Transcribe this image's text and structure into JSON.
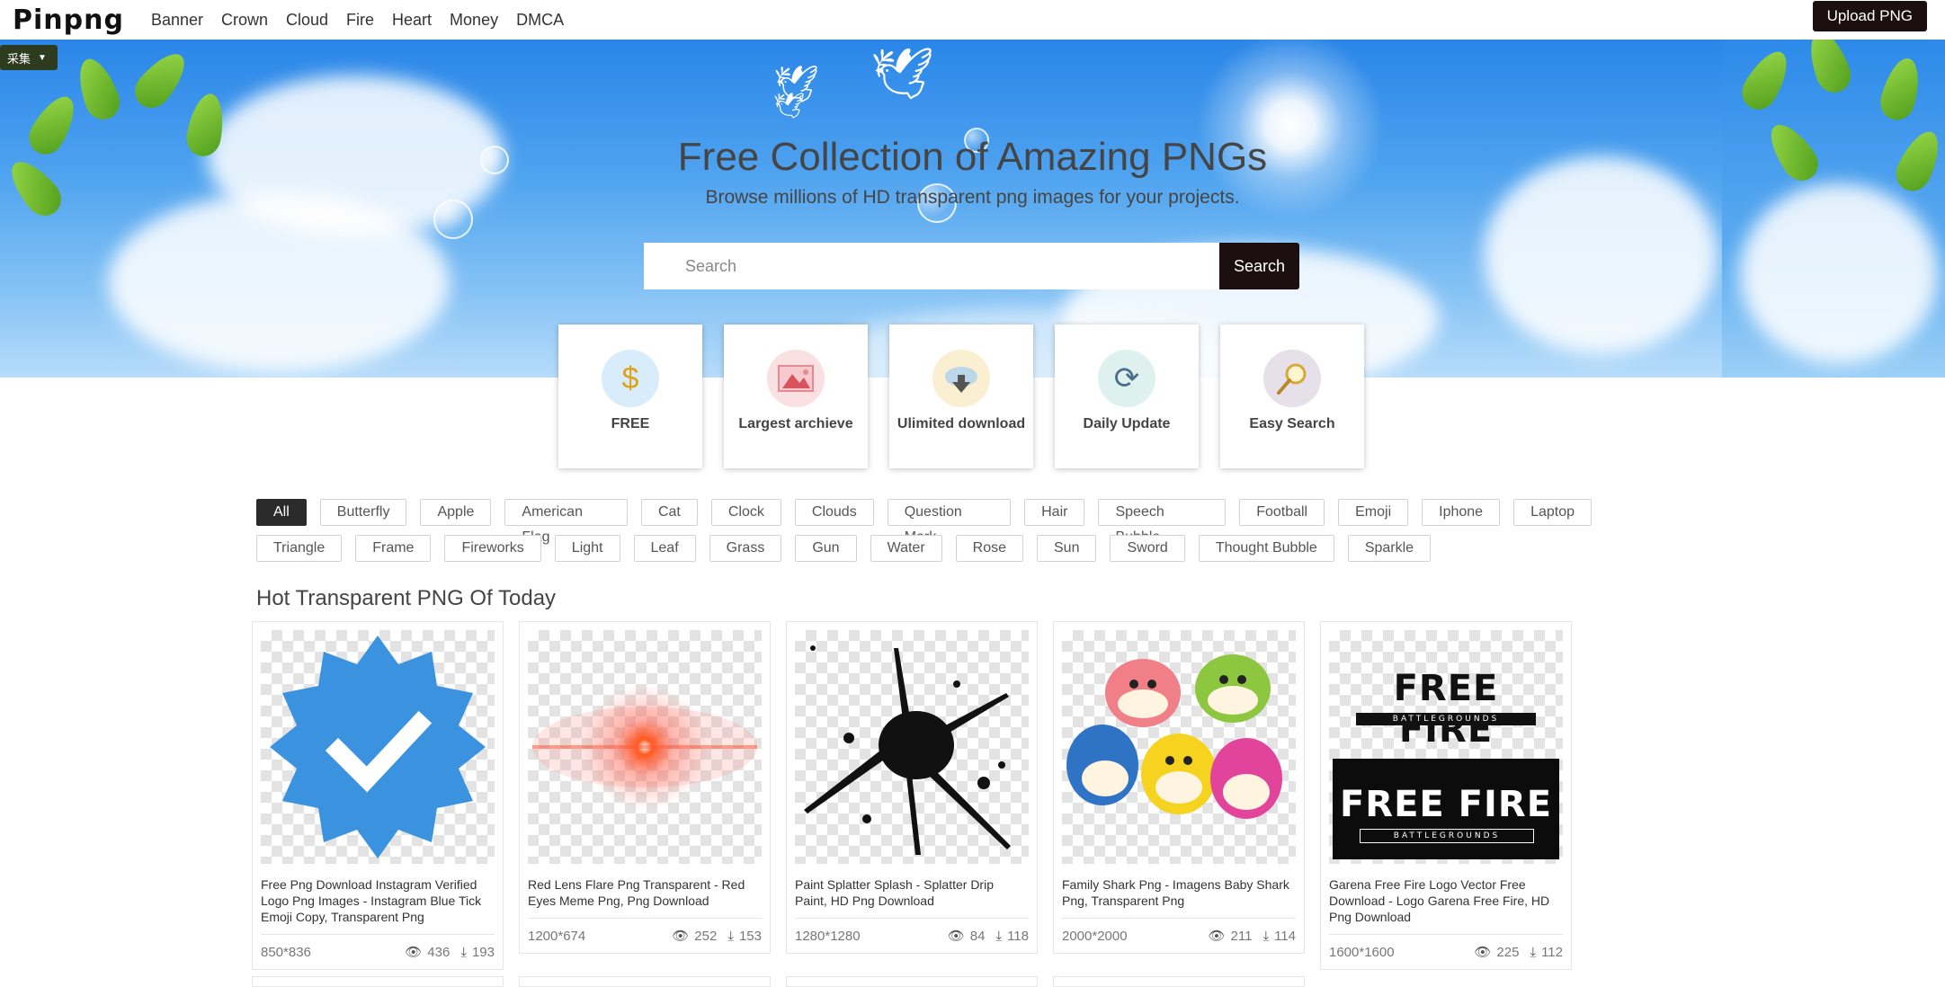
{
  "nav": {
    "logo": "Pinpng",
    "links": [
      "Banner",
      "Crown",
      "Cloud",
      "Fire",
      "Heart",
      "Money",
      "DMCA"
    ],
    "upload_label": "Upload PNG"
  },
  "overlay_badge": {
    "label": "采集",
    "dropdown_icon": "caret-down-icon"
  },
  "hero": {
    "title": "Free Collection of Amazing PNGs",
    "subtitle": "Browse millions of HD transparent png images for your projects.",
    "search": {
      "placeholder": "Search",
      "button_label": "Search"
    }
  },
  "features": [
    {
      "label": "FREE",
      "icon": "dollar-icon",
      "color": "#d9ecfb"
    },
    {
      "label": "Largest archieve",
      "icon": "image-icon",
      "color": "#fbe0e3"
    },
    {
      "label": "Ulimited download",
      "icon": "cloud-download-icon",
      "color": "#fbefd2"
    },
    {
      "label": "Daily Update",
      "icon": "refresh-icon",
      "color": "#dff1ee"
    },
    {
      "label": "Easy Search",
      "icon": "magnifier-icon",
      "color": "#e6e0ea"
    }
  ],
  "tags": {
    "row1": [
      "All",
      "Butterfly",
      "Apple",
      "American Flag",
      "Cat",
      "Clock",
      "Clouds",
      "Question Mark",
      "Hair",
      "Speech Bubble",
      "Football",
      "Emoji",
      "Iphone",
      "Laptop"
    ],
    "row2": [
      "Triangle",
      "Frame",
      "Fireworks",
      "Light",
      "Leaf",
      "Grass",
      "Gun",
      "Water",
      "Rose",
      "Sun",
      "Sword",
      "Thought Bubble",
      "Sparkle"
    ],
    "active": "All"
  },
  "section_title": "Hot Transparent PNG Of Today",
  "cards": [
    {
      "title": "Free Png Download Instagram Verified Logo Png Images - Instagram Blue Tick Emoji Copy, Transparent Png",
      "dims": "850*836",
      "views": "436",
      "downloads": "193"
    },
    {
      "title": "Red Lens Flare Png Transparent - Red Eyes Meme Png, Png Download",
      "dims": "1200*674",
      "views": "252",
      "downloads": "153"
    },
    {
      "title": "Paint Splatter Splash - Splatter Drip Paint, HD Png Download",
      "dims": "1280*1280",
      "views": "84",
      "downloads": "118"
    },
    {
      "title": "Family Shark Png - Imagens Baby Shark Png, Transparent Png",
      "dims": "2000*2000",
      "views": "211",
      "downloads": "114"
    },
    {
      "title": "Garena Free Fire Logo Vector Free Download - Logo Garena Free Fire, HD Png Download",
      "dims": "1600*1600",
      "views": "225",
      "downloads": "112"
    }
  ],
  "logo_texts": {
    "free_fire": "FREE FIRE",
    "battlegrounds": "BATTLEGROUNDS"
  }
}
